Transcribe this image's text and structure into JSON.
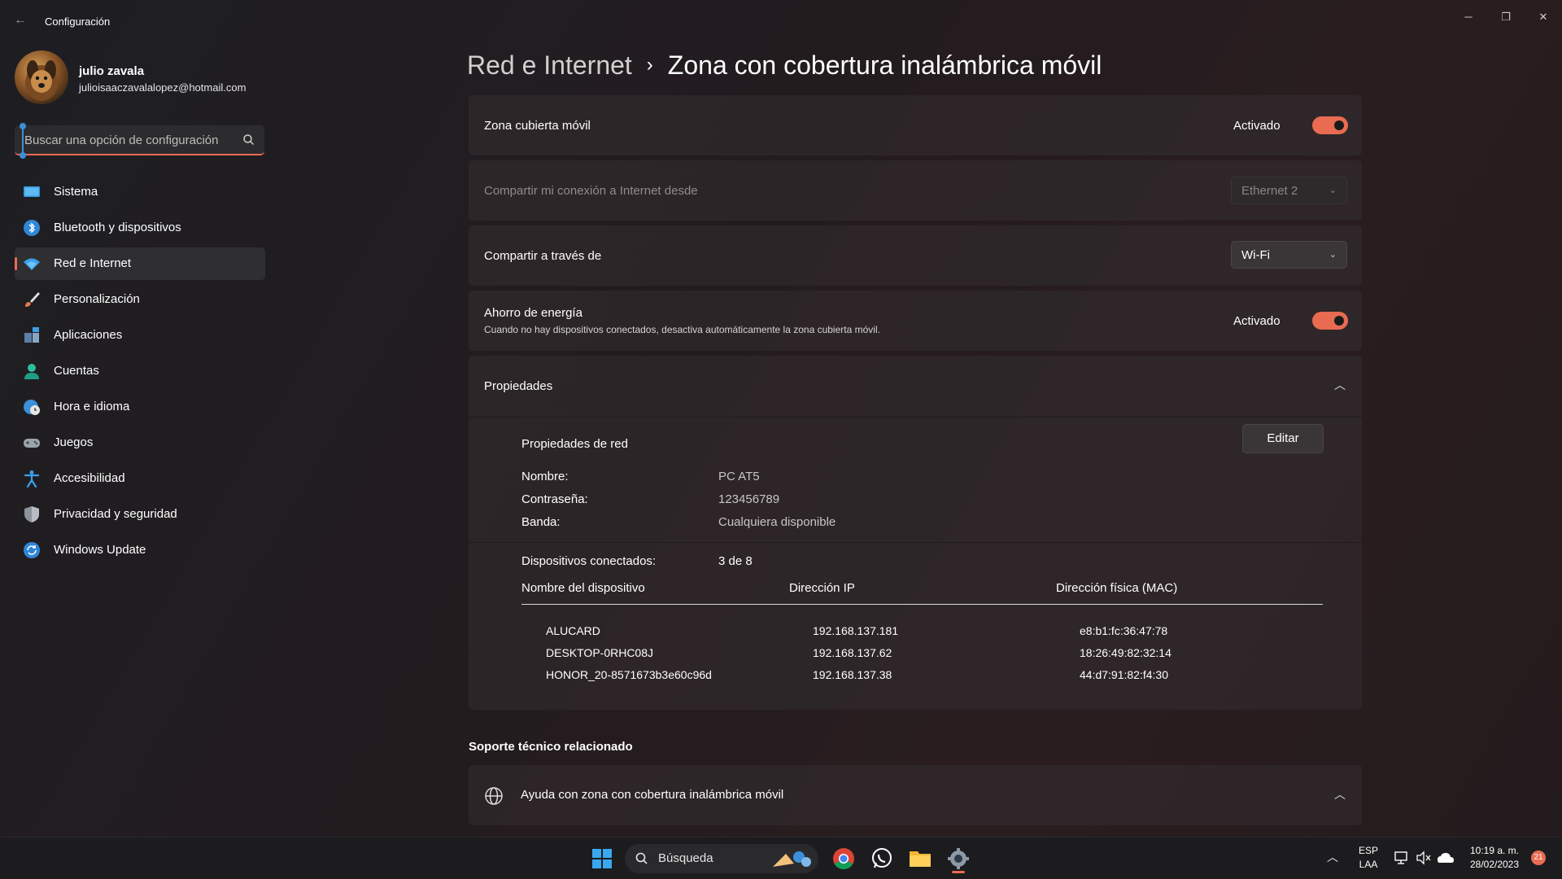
{
  "window": {
    "title": "Configuración",
    "back_icon": "back-arrow-icon",
    "controls": {
      "minimize": "─",
      "maximize": "❐",
      "close": "✕"
    }
  },
  "profile": {
    "name": "julio zavala",
    "email": "julioisaaczavalalopez@hotmail.com"
  },
  "search": {
    "placeholder": "Buscar una opción de configuración"
  },
  "sidebar": {
    "items": [
      {
        "label": "Sistema",
        "icon": "monitor-icon"
      },
      {
        "label": "Bluetooth y dispositivos",
        "icon": "bluetooth-icon"
      },
      {
        "label": "Red e Internet",
        "icon": "wifi-icon",
        "active": true
      },
      {
        "label": "Personalización",
        "icon": "brush-icon"
      },
      {
        "label": "Aplicaciones",
        "icon": "apps-icon"
      },
      {
        "label": "Cuentas",
        "icon": "person-icon"
      },
      {
        "label": "Hora e idioma",
        "icon": "globe-clock-icon"
      },
      {
        "label": "Juegos",
        "icon": "gamepad-icon"
      },
      {
        "label": "Accesibilidad",
        "icon": "accessibility-icon"
      },
      {
        "label": "Privacidad y seguridad",
        "icon": "shield-icon"
      },
      {
        "label": "Windows Update",
        "icon": "update-icon"
      }
    ]
  },
  "breadcrumb": {
    "parent": "Red e Internet",
    "separator": "›",
    "current": "Zona con cobertura inalámbrica móvil"
  },
  "hotspot": {
    "label": "Zona cubierta móvil",
    "state": "Activado",
    "on": true
  },
  "share_from": {
    "label": "Compartir mi conexión a Internet desde",
    "value": "Ethernet 2",
    "disabled": true
  },
  "share_via": {
    "label": "Compartir a través de",
    "value": "Wi-Fi"
  },
  "power_saving": {
    "label": "Ahorro de energía",
    "description": "Cuando no hay dispositivos conectados, desactiva automáticamente la zona cubierta móvil.",
    "state": "Activado",
    "on": true
  },
  "properties": {
    "header": "Propiedades",
    "network_title": "Propiedades de red",
    "edit_label": "Editar",
    "fields": [
      {
        "key": "Nombre:",
        "value": "PC AT5"
      },
      {
        "key": "Contraseña:",
        "value": "123456789"
      },
      {
        "key": "Banda:",
        "value": "Cualquiera disponible"
      }
    ],
    "connected_label": "Dispositivos conectados:",
    "connected_value": "3 de 8",
    "columns": [
      "Nombre del dispositivo",
      "Dirección IP",
      "Dirección física (MAC)"
    ],
    "devices": [
      {
        "name": "ALUCARD",
        "ip": "192.168.137.181",
        "mac": "e8:b1:fc:36:47:78"
      },
      {
        "name": "DESKTOP-0RHC08J",
        "ip": "192.168.137.62",
        "mac": "18:26:49:82:32:14"
      },
      {
        "name": "HONOR_20-8571673b3e60c96d",
        "ip": "192.168.137.38",
        "mac": "44:d7:91:82:f4:30"
      }
    ]
  },
  "support": {
    "title": "Soporte técnico relacionado",
    "help_item": "Ayuda con zona con cobertura inalámbrica móvil"
  },
  "taskbar": {
    "search_label": "Búsqueda",
    "lang_top": "ESP",
    "lang_bottom": "LAA",
    "time": "10:19 a. m.",
    "date": "28/02/2023",
    "notifications": "21"
  },
  "colors": {
    "accent": "#e86b52",
    "background": "#202022",
    "card": "#302a2d"
  }
}
